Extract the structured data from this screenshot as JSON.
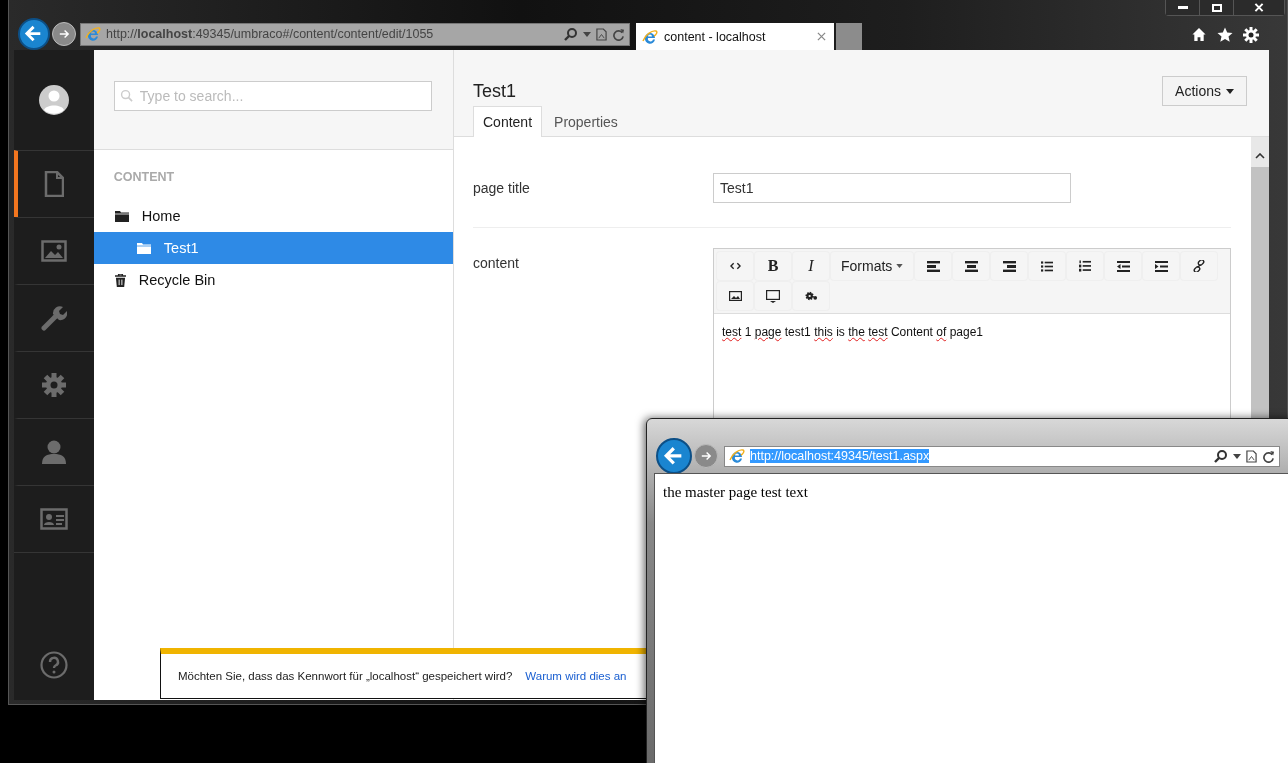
{
  "browser": {
    "url": "http://**localhost**:49345/umbraco#/content/content/edit/1055",
    "tab_title": "content - localhost"
  },
  "sidebar": {
    "sections": [
      {
        "kind": "document",
        "selected": true
      },
      {
        "kind": "image",
        "selected": false
      },
      {
        "kind": "wrench",
        "selected": false
      },
      {
        "kind": "gear",
        "selected": false
      },
      {
        "kind": "person",
        "selected": false
      },
      {
        "kind": "card",
        "selected": false
      }
    ]
  },
  "tree": {
    "search_placeholder": "Type to search...",
    "heading": "CONTENT",
    "items": [
      {
        "label": "Home",
        "kind": "folder",
        "selected": false,
        "children": [
          {
            "label": "Test1",
            "kind": "folder",
            "selected": true
          }
        ]
      },
      {
        "label": "Recycle Bin",
        "kind": "bin",
        "selected": false
      }
    ]
  },
  "editor": {
    "title": "Test1",
    "actions": "Actions",
    "tabs": [
      {
        "label": "Content",
        "selected": true
      },
      {
        "label": "Properties",
        "selected": false
      }
    ],
    "fields": [
      {
        "label": "page title",
        "kind": "text",
        "value": "Test1"
      },
      {
        "label": "content",
        "kind": "richtext",
        "toolbar": [
          {
            "kind": "icon"
          },
          {
            "kind": "glyph",
            "label": "B"
          },
          {
            "kind": "glyph",
            "label": "I"
          },
          {
            "kind": "dropdown",
            "label": "Formats"
          },
          {
            "kind": "icon"
          },
          {
            "kind": "icon"
          },
          {
            "kind": "icon"
          },
          {
            "kind": "icon"
          },
          {
            "kind": "icon"
          },
          {
            "kind": "icon"
          },
          {
            "kind": "icon"
          },
          {
            "kind": "icon"
          },
          {
            "kind": "icon"
          },
          {
            "kind": "icon"
          },
          {
            "kind": "icon"
          }
        ],
        "words": [
          {
            "text": "test",
            "misspelled": true
          },
          {
            "text": "1",
            "misspelled": false
          },
          {
            "text": "page",
            "misspelled": true
          },
          {
            "text": "test1",
            "misspelled": false
          },
          {
            "text": "this",
            "misspelled": true
          },
          {
            "text": "is",
            "misspelled": false
          },
          {
            "text": "the",
            "misspelled": true
          },
          {
            "text": "test",
            "misspelled": true
          },
          {
            "text": "Content",
            "misspelled": false
          },
          {
            "text": "of",
            "misspelled": true
          },
          {
            "text": "page1",
            "misspelled": false
          }
        ]
      }
    ]
  },
  "password_bar": {
    "message": "Möchten Sie, dass das Kennwort für „localhost“ gespeichert wird?",
    "link": "Warum wird dies an"
  },
  "popup_window": {
    "url": "http://localhost:49345/test1.aspx",
    "url_selected": true,
    "body_text": "the master page test text"
  }
}
